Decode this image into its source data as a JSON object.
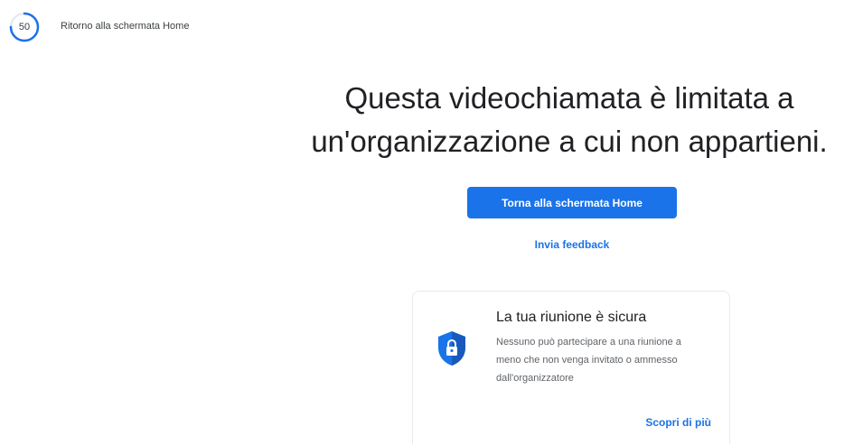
{
  "countdown": {
    "value": "50",
    "progress_fraction": 0.75,
    "accent_color": "#1a73e8",
    "return_text": "Ritorno alla schermata Home"
  },
  "main": {
    "headline": "Questa videochiamata è limitata a un'organizzazione a cui non appartieni.",
    "primary_button_label": "Torna alla schermata Home",
    "feedback_link": "Invia feedback"
  },
  "security_card": {
    "icon": "shield-lock-icon",
    "title": "La tua riunione è sicura",
    "body": "Nessuno può partecipare a una riunione a meno che non venga invitato o ammesso dall'organizzatore",
    "learn_more_link": "Scopri di più"
  },
  "colors": {
    "primary": "#1a73e8",
    "text_dark": "#202124",
    "text_muted": "#5f6368"
  }
}
